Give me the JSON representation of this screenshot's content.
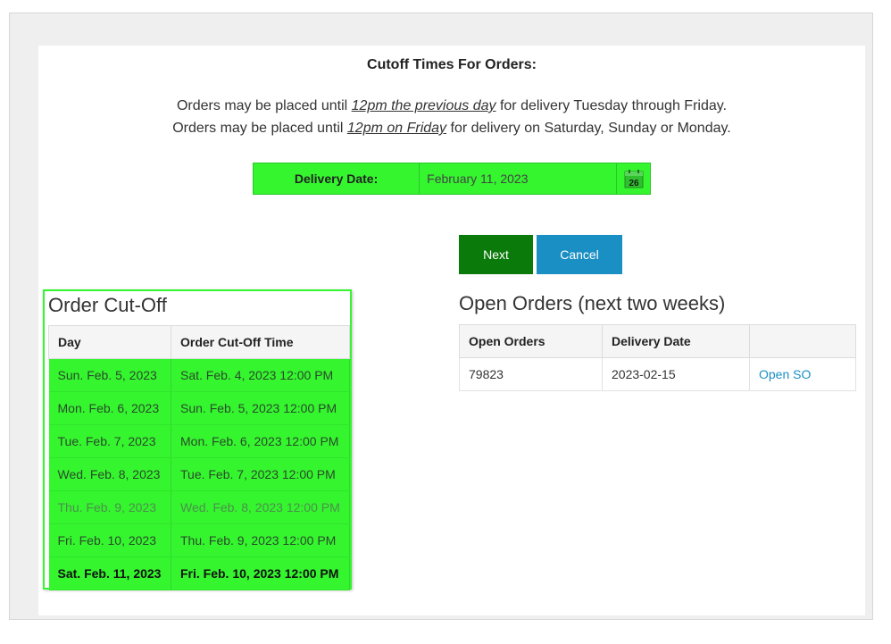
{
  "heading": "Cutoff Times For Orders:",
  "rules": [
    {
      "pre": "Orders may be placed until ",
      "highlight": "12pm the previous day",
      "post": " for delivery Tuesday through Friday."
    },
    {
      "pre": "Orders may be placed until ",
      "highlight": "12pm on Friday",
      "post": " for delivery on Saturday, Sunday or Monday."
    }
  ],
  "delivery": {
    "label": "Delivery Date:",
    "value": "February 11, 2023",
    "calendar_icon": "calendar-icon",
    "calendar_day": "26"
  },
  "buttons": {
    "next": "Next",
    "cancel": "Cancel"
  },
  "cutoff": {
    "title": "Order Cut-Off",
    "columns": [
      "Day",
      "Order Cut-Off Time"
    ],
    "rows": [
      {
        "day": "Sun. Feb. 5, 2023",
        "time": "Sat. Feb. 4, 2023 12:00 PM"
      },
      {
        "day": "Mon. Feb. 6, 2023",
        "time": "Sun. Feb. 5, 2023 12:00 PM"
      },
      {
        "day": "Tue. Feb. 7, 2023",
        "time": "Mon. Feb. 6, 2023 12:00 PM"
      },
      {
        "day": "Wed. Feb. 8, 2023",
        "time": "Tue. Feb. 7, 2023 12:00 PM"
      },
      {
        "day": "Thu. Feb. 9, 2023",
        "time": "Wed. Feb. 8, 2023 12:00 PM"
      },
      {
        "day": "Fri. Feb. 10, 2023",
        "time": "Thu. Feb. 9, 2023 12:00 PM"
      },
      {
        "day": "Sat. Feb. 11, 2023",
        "time": "Fri. Feb. 10, 2023 12:00 PM"
      }
    ]
  },
  "open_orders": {
    "title": "Open Orders (next two weeks)",
    "columns": [
      "Open Orders",
      "Delivery Date",
      ""
    ],
    "rows": [
      {
        "order": "79823",
        "date": "2023-02-15",
        "link": "Open SO"
      }
    ]
  },
  "colors": {
    "highlight_green": "#35f52f",
    "next_button": "#0a7a0a",
    "cancel_button": "#1a8fc4",
    "link": "#1a8fc4"
  }
}
